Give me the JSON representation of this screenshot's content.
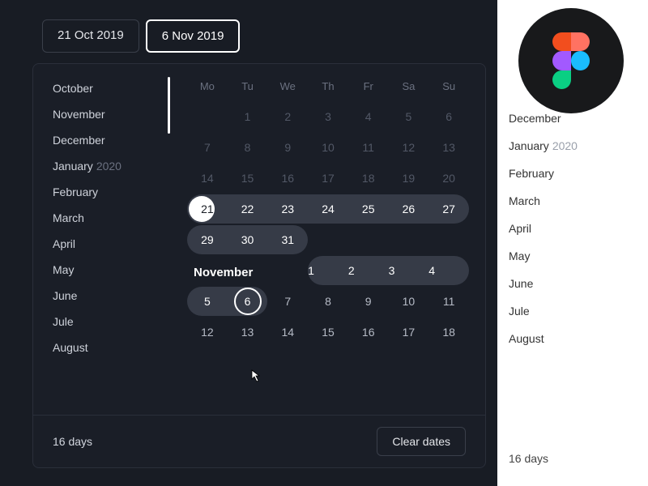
{
  "inputs": {
    "start": "21 Oct 2019",
    "end": "6 Nov 2019"
  },
  "monthList": {
    "items": [
      {
        "label": "October",
        "year": ""
      },
      {
        "label": "November",
        "year": ""
      },
      {
        "label": "December",
        "year": ""
      },
      {
        "label": "January",
        "year": "2020"
      },
      {
        "label": "February",
        "year": ""
      },
      {
        "label": "March",
        "year": ""
      },
      {
        "label": "April",
        "year": ""
      },
      {
        "label": "May",
        "year": ""
      },
      {
        "label": "June",
        "year": ""
      },
      {
        "label": "Jule",
        "year": ""
      },
      {
        "label": "August",
        "year": ""
      }
    ]
  },
  "weekdays": [
    "Mo",
    "Tu",
    "We",
    "Th",
    "Fr",
    "Sa",
    "Su"
  ],
  "october": {
    "rows": [
      [
        "",
        "1",
        "2",
        "3",
        "4",
        "5",
        "6"
      ],
      [
        "7",
        "8",
        "9",
        "10",
        "11",
        "12",
        "13"
      ],
      [
        "14",
        "15",
        "16",
        "17",
        "18",
        "19",
        "20"
      ]
    ],
    "rangeRow4": [
      "21",
      "22",
      "23",
      "24",
      "25",
      "26",
      "27"
    ],
    "rangeRow5": [
      "29",
      "30",
      "31"
    ]
  },
  "november": {
    "title": "November",
    "headerPill": [
      "1",
      "2",
      "3",
      "4"
    ],
    "row2a": [
      "5",
      "6"
    ],
    "row2b": [
      "7",
      "8",
      "9",
      "10",
      "11"
    ],
    "row3": [
      "12",
      "13",
      "14",
      "15",
      "16",
      "17",
      "18"
    ]
  },
  "footer": {
    "daysCount": "16 days",
    "clear": "Clear dates"
  },
  "lightSidebar": {
    "items": [
      {
        "label": "December",
        "year": ""
      },
      {
        "label": "January",
        "year": "2020"
      },
      {
        "label": "February",
        "year": ""
      },
      {
        "label": "March",
        "year": ""
      },
      {
        "label": "April",
        "year": ""
      },
      {
        "label": "May",
        "year": ""
      },
      {
        "label": "June",
        "year": ""
      },
      {
        "label": "Jule",
        "year": ""
      },
      {
        "label": "August",
        "year": ""
      }
    ],
    "footer": "16 days"
  }
}
